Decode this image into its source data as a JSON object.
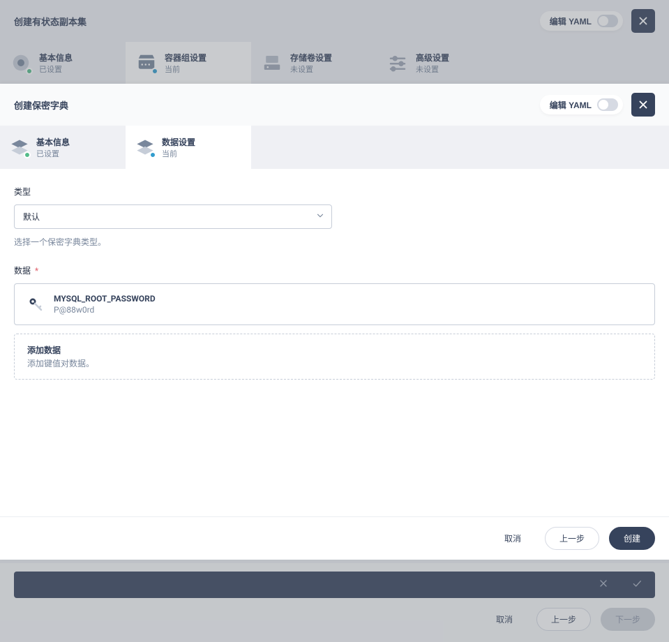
{
  "background": {
    "title": "创建有状态副本集",
    "yaml_label": "编辑 YAML",
    "steps": [
      {
        "label": "基本信息",
        "status": "已设置"
      },
      {
        "label": "容器组设置",
        "status": "当前"
      },
      {
        "label": "存储卷设置",
        "status": "未设置"
      },
      {
        "label": "高级设置",
        "status": "未设置"
      }
    ],
    "footer": {
      "cancel": "取消",
      "prev": "上一步",
      "next": "下一步"
    }
  },
  "modal": {
    "title": "创建保密字典",
    "yaml_label": "编辑 YAML",
    "steps": [
      {
        "label": "基本信息",
        "status": "已设置"
      },
      {
        "label": "数据设置",
        "status": "当前"
      }
    ],
    "type_label": "类型",
    "type_value": "默认",
    "type_help": "选择一个保密字典类型。",
    "data_label": "数据",
    "entries": [
      {
        "key": "MYSQL_ROOT_PASSWORD",
        "value": "P@88w0rd"
      }
    ],
    "add": {
      "title": "添加数据",
      "sub": "添加键值对数据。"
    },
    "footer": {
      "cancel": "取消",
      "prev": "上一步",
      "create": "创建"
    }
  }
}
